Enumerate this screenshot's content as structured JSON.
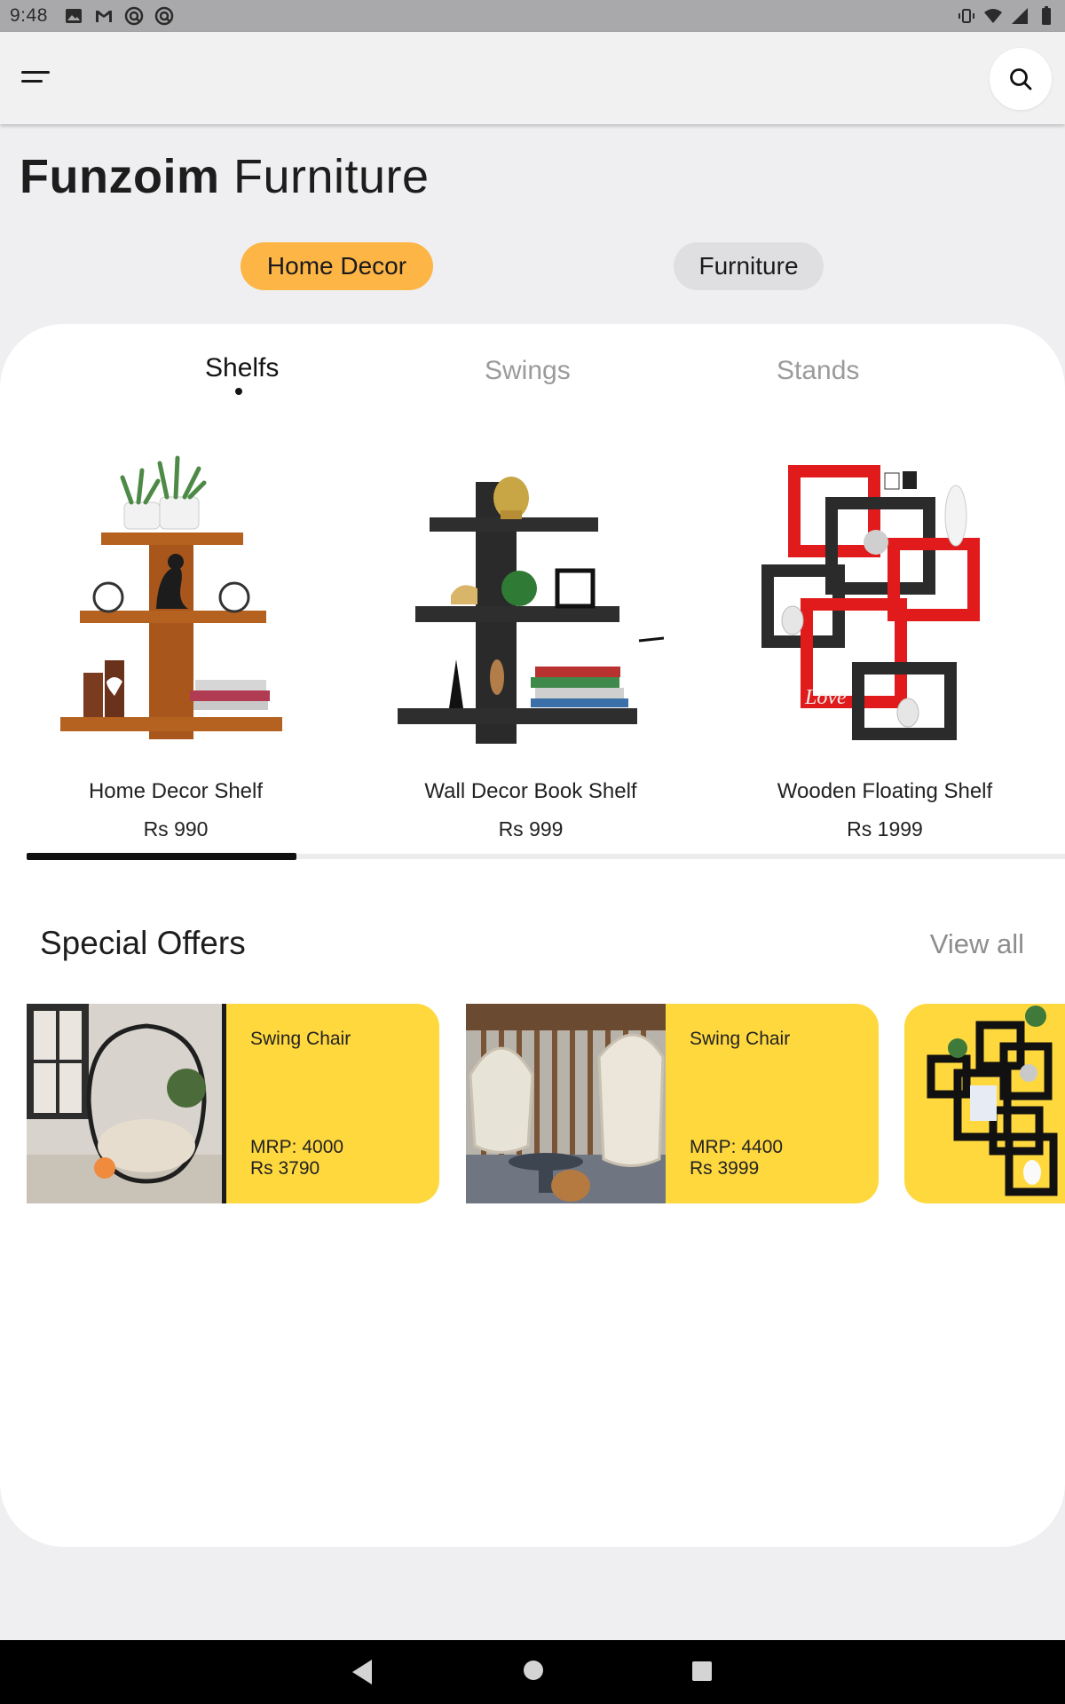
{
  "status_bar": {
    "time": "9:48",
    "left_icons": [
      "image-icon",
      "gmail-icon",
      "sync-icon",
      "sync-icon"
    ],
    "right_icons": [
      "vibrate-icon",
      "wifi-icon",
      "signal-icon",
      "battery-icon"
    ]
  },
  "app_bar": {
    "menu_icon": "menu-icon",
    "search_icon": "search-icon"
  },
  "brand": {
    "bold": "Funzoim",
    "light": "Furniture"
  },
  "categories": [
    {
      "label": "Home Decor",
      "active": true
    },
    {
      "label": "Furniture",
      "active": false
    }
  ],
  "subtabs": [
    {
      "label": "Shelfs",
      "active": true
    },
    {
      "label": "Swings",
      "active": false
    },
    {
      "label": "Stands",
      "active": false
    }
  ],
  "products": [
    {
      "name": "Home Decor Shelf",
      "price": "Rs 990"
    },
    {
      "name": "Wall Decor Book Shelf",
      "price": "Rs 999"
    },
    {
      "name": "Wooden Floating Shelf",
      "price": "Rs 1999"
    }
  ],
  "products_scroll_fraction": 0.26,
  "special_offers": {
    "title": "Special Offers",
    "view_all": "View all",
    "items": [
      {
        "title": "Swing Chair",
        "mrp": "MRP: 4000",
        "price": "Rs 3790"
      },
      {
        "title": "Swing Chair",
        "mrp": "MRP: 4400",
        "price": "Rs 3999"
      }
    ]
  },
  "colors": {
    "accent_pill": "#fdb546",
    "offer_card": "#ffd83e",
    "inactive_pill": "#dfdfe1"
  },
  "nav_bar": {
    "back": "back-icon",
    "home": "home-icon",
    "recents": "recents-icon"
  }
}
